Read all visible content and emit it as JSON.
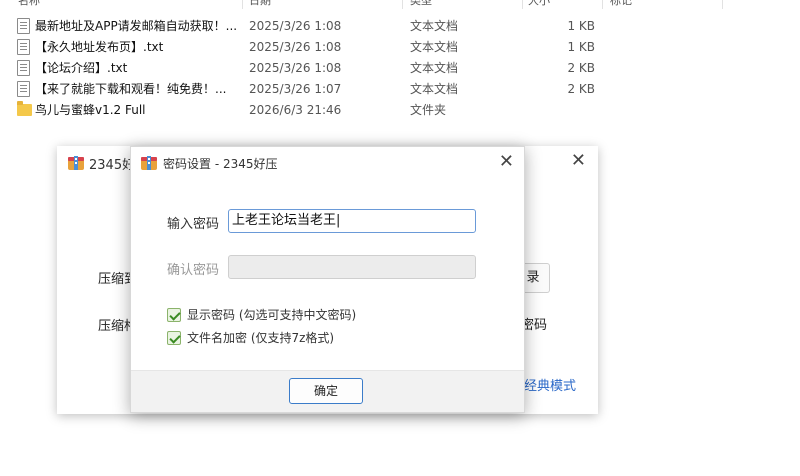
{
  "explorer": {
    "header": [
      "名称",
      "日期",
      "类型",
      "大小",
      "标记"
    ],
    "files": [
      {
        "name": "最新地址及APP请发邮箱自动获取！...",
        "date": "2025/3/26 1:08",
        "type": "文本文档",
        "size": "1 KB",
        "icon": "text-file-icon"
      },
      {
        "name": "【永久地址发布页】.txt",
        "date": "2025/3/26 1:08",
        "type": "文本文档",
        "size": "1 KB",
        "icon": "text-file-icon"
      },
      {
        "name": "【论坛介绍】.txt",
        "date": "2025/3/26 1:08",
        "type": "文本文档",
        "size": "2 KB",
        "icon": "text-file-icon"
      },
      {
        "name": "【来了就能下载和观看！纯免费！...",
        "date": "2025/3/26 1:07",
        "type": "文本文档",
        "size": "2 KB",
        "icon": "text-file-icon"
      },
      {
        "name": "鸟儿与蜜蜂v1.2 Full",
        "date": "2026/6/3 21:46",
        "type": "文件夹",
        "size": "",
        "icon": "folder-icon"
      }
    ]
  },
  "main_dialog": {
    "title": "2345好",
    "label_compress_to": "压缩到",
    "label_compress_fmt": "压缩格",
    "browse_button_fragment": "录",
    "password_fragment": "密码",
    "classic_mode_link": "经典模式"
  },
  "password_dialog": {
    "title": "密码设置 - 2345好压",
    "password_label": "输入密码",
    "password_value": "上老王论坛当老王|",
    "confirm_label": "确认密码",
    "confirm_value": "",
    "show_password_label": "显示密码 (勾选可支持中文密码)",
    "encrypt_filename_label": "文件名加密  (仅支持7z格式)",
    "ok_label": "确定"
  },
  "colors": {
    "accent": "#3b7cc9",
    "checkbox_green": "#3a8b22",
    "folder": "#f4c84a",
    "link": "#2a68c8"
  }
}
